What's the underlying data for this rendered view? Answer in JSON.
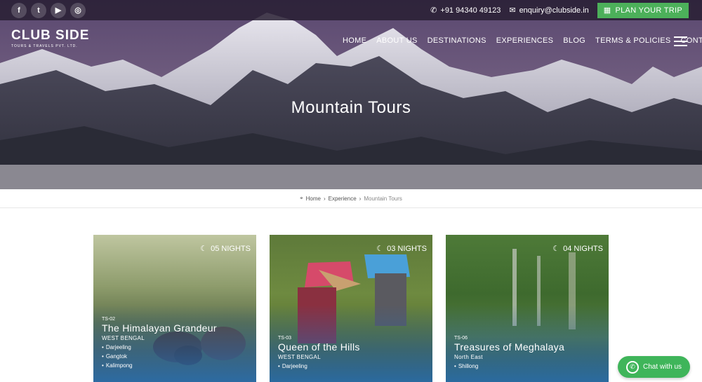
{
  "topbar": {
    "social": [
      {
        "icon": "facebook-icon",
        "glyph": "f"
      },
      {
        "icon": "twitter-icon",
        "glyph": "t"
      },
      {
        "icon": "youtube-icon",
        "glyph": "▶"
      },
      {
        "icon": "instagram-icon",
        "glyph": "◎"
      }
    ],
    "phone": "+91 94340 49123",
    "email": "enquiry@clubside.in",
    "plan_label": "PLAN YOUR TRIP"
  },
  "brand": {
    "name": "CLUB SIDE",
    "tagline": "TOURS & TRAVELS PVT. LTD."
  },
  "nav": [
    "HOME",
    "ABOUT US",
    "DESTINATIONS",
    "EXPERIENCES",
    "BLOG",
    "TERMS & POLICIES",
    "CONTACT"
  ],
  "hero": {
    "title": "Mountain Tours"
  },
  "breadcrumb": {
    "home": "Home",
    "sep": "›",
    "experience": "Experience",
    "current": "Mountain Tours"
  },
  "cards": [
    {
      "nights": "05 NIGHTS",
      "code": "TS-02",
      "title": "The Himalayan Grandeur",
      "region": "WEST BENGAL",
      "places": [
        "Darjeeling",
        "Gangtok",
        "Kalimpong"
      ]
    },
    {
      "nights": "03 NIGHTS",
      "code": "TS-03",
      "title": "Queen of the Hills",
      "region": "WEST BENGAL",
      "places": [
        "Darjeeling"
      ]
    },
    {
      "nights": "04 NIGHTS",
      "code": "TS-06",
      "title": "Treasures of Meghalaya",
      "region": "North East",
      "places": [
        "Shillong"
      ]
    }
  ],
  "chat": {
    "label": "Chat with us"
  },
  "colors": {
    "accent_green": "#4cb05a",
    "chat_green": "#3fb55a",
    "topbar": "#281e32"
  }
}
